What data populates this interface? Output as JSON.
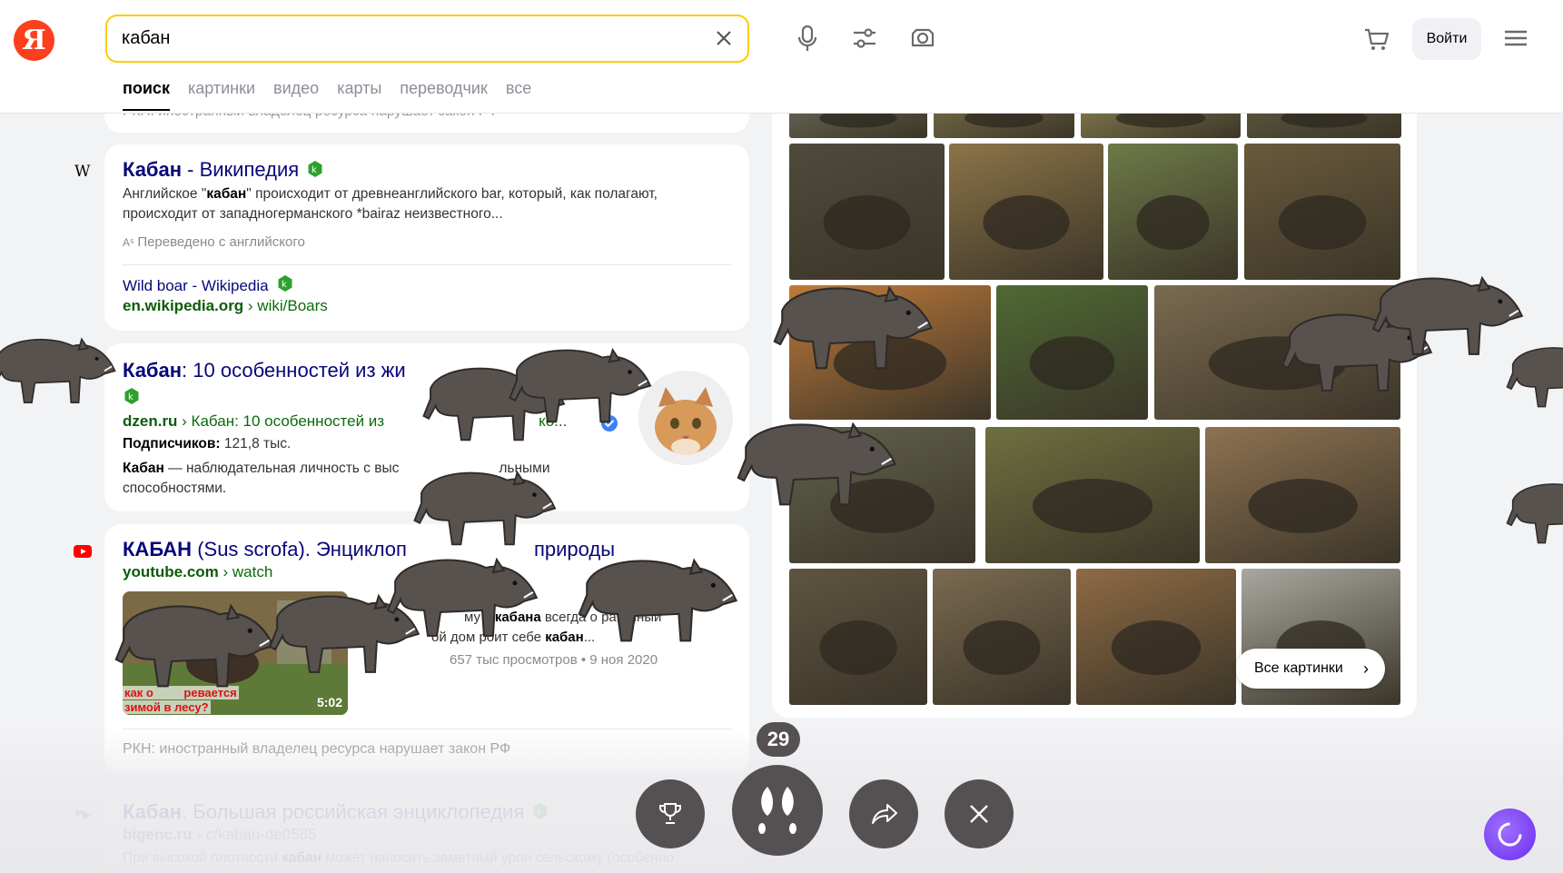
{
  "header": {
    "logo_text": "Я",
    "search_value": "кабан",
    "login_label": "Войти",
    "tabs": [
      "поиск",
      "картинки",
      "видео",
      "карты",
      "переводчик",
      "все"
    ]
  },
  "partial_top_text": "РКН: иностранный владелец ресурса нарушает закон РФ",
  "results": [
    {
      "title_bold": "Кабан",
      "title_rest": " - Википедия",
      "snippet_line1_a": "Английское \"",
      "snippet_line1_b": "кабан",
      "snippet_line1_c": "\" происходит от древнеанглийского bar, который, как полагают,",
      "snippet_line2": "происходит от западногерманского *bairaz неизвестного...",
      "translated": "Переведено с английского",
      "sub_title": "Wild boar - Wikipedia",
      "sub_src_domain": "en.wikipedia.org",
      "sub_src_path": " › wiki/Boars"
    },
    {
      "title_bold": "Кабан",
      "title_rest": ": 10 особенностей из жи",
      "src_domain": "dzen.ru",
      "src_path": " › Кабан: 10 особенностей из",
      "src_tail": "ко...",
      "subs_label": "Подписчиков:",
      "subs_value": " 121,8 тыс.",
      "snippet_a": "Кабан",
      "snippet_b": " — наблюдательная личность с выс",
      "snippet_c": "льными",
      "snippet_line2": "способностями."
    },
    {
      "title_bold": "КАБАН",
      "title_rest": " (Sus scrofa). Энциклоп",
      "title_tail": "природы",
      "src_domain": "youtube.com",
      "src_path": " › watch",
      "snippet_frag1": "ч",
      "snippet_frag2": "му у",
      "snippet_bold1": "кабана",
      "snippet_frag3": " всегда о",
      "snippet_frag4": "раточ",
      "snippet_frag5": "ный",
      "snippet_frag6": "ой дом",
      "snippet_frag7": "роит себе",
      "snippet_bold2": "кабан",
      "snippet_frag8": "...",
      "views": "657 тыс. просмотров • 9 ноя 2020",
      "views_visible": "657 тыс просмотров",
      "date": "• 9 ноя 2020",
      "video_caption1": "как о",
      "video_caption2": "ревается",
      "video_caption3": "зимой в лесу?",
      "duration": "5:02",
      "rkn_notice": "РКН: иностранный владелец ресурса нарушает закон РФ"
    },
    {
      "title_bold": "Кабан",
      "title_rest": ". Большая российская энциклопедия",
      "src_domain": "bigenc.ru",
      "src_path": " › c/kaban-de0585",
      "snippet_a": "При высокой плотности ",
      "snippet_b": "кабан",
      "snippet_c": " может наносить заметный урон сельскому (особенно"
    }
  ],
  "images_panel": {
    "all_images_label": "Все картинки"
  },
  "game": {
    "counter": "29"
  },
  "colors": {
    "accent_yellow": "#ffcc00",
    "logo_red": "#fc3f1d",
    "title_blue": "#07077a",
    "source_green": "#0b6b0b",
    "game_button": "#555152",
    "alice_purple": "#6a2cf0"
  },
  "icons": [
    "yandex-logo",
    "clear-icon",
    "microphone-icon",
    "filters-icon",
    "camera-search-icon",
    "cart-icon",
    "menu-icon",
    "verified-badge-icon",
    "wikipedia-icon",
    "youtube-icon",
    "bigenc-icon",
    "trophy-icon",
    "hoofprint-icon",
    "share-icon",
    "close-icon",
    "alice-icon",
    "boar-sprite"
  ]
}
